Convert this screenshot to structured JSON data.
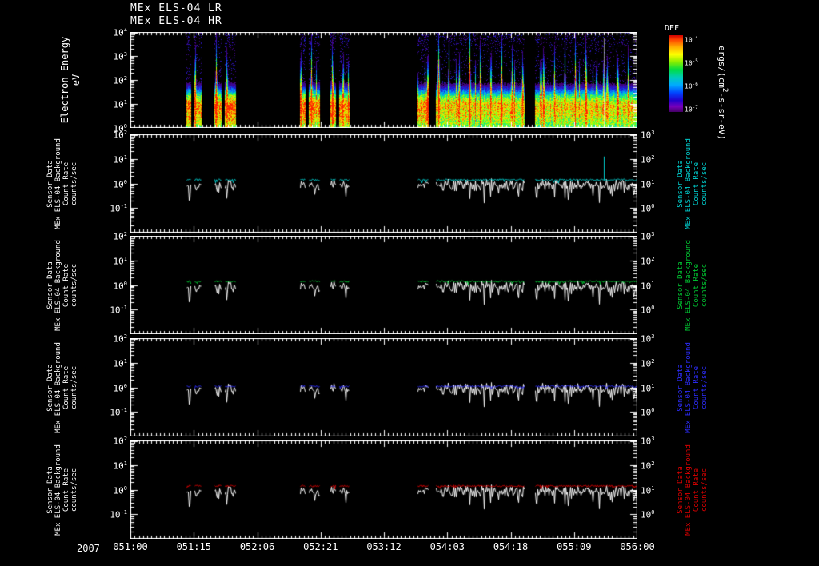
{
  "titles": {
    "line1": "MEx ELS-04 LR",
    "line2": "MEx ELS-04 HR"
  },
  "spectrogram_labels": {
    "ylabel_line1": "Electron Energy",
    "ylabel_line2": "eV",
    "colorbar_title": "DEF",
    "units_label": "ergs/(cm^2-s-sr-eV)"
  },
  "sensor_label_lines": [
    "Sensor Data",
    "MEx ELS-04 Background",
    "Count Rate",
    "counts/sec"
  ],
  "x_axis": {
    "year": "2007"
  },
  "chart_data": {
    "type": "multi-panel-time-series",
    "title": "MEx ELS-04 LR / MEx ELS-04 HR",
    "time_axis": {
      "year": "2007",
      "start_doy_hour": "051:00",
      "end_doy_hour": "056:00",
      "span_hours": 120,
      "tick_interval_hours": 15,
      "tick_labels": [
        "051:00",
        "051:15",
        "052:06",
        "052:21",
        "053:12",
        "054:03",
        "054:18",
        "055:09",
        "056:00"
      ]
    },
    "data_segments_hours": [
      [
        13.2,
        14.4
      ],
      [
        15.1,
        16.9
      ],
      [
        19.9,
        21.5
      ],
      [
        22.3,
        24.9
      ],
      [
        40.1,
        41.5
      ],
      [
        42.3,
        44.8
      ],
      [
        47.3,
        48.6
      ],
      [
        49.4,
        51.8
      ],
      [
        68.0,
        70.6
      ],
      [
        72.3,
        93.3
      ],
      [
        95.8,
        120
      ]
    ],
    "panels": [
      {
        "type": "heatmap",
        "name": "electron-energy-spectrogram",
        "ylabel": "Electron Energy (eV)",
        "yscale": "log",
        "ylim_eV": [
          1,
          10000
        ],
        "y_tick_exponents": [
          4,
          3,
          2,
          1,
          0
        ],
        "colorbar": {
          "label": "DEF",
          "units": "ergs/(cm^2-s-sr-eV)",
          "tick_exponents": [
            -4,
            -5,
            -6,
            -7
          ],
          "palette": "rainbow"
        },
        "artifact_line_hour": 112,
        "features": "Peak differential energy flux (green-yellow) between ~3 and 30 eV; enhancements (cyan-blue) reaching ~1000 eV as vertical striations roughly every 2.5 h; sparse purple counts up to 10^4 eV; black where no data."
      },
      {
        "type": "line",
        "name": "count-rate-panel-cyan",
        "yscale": "log",
        "left_axis": {
          "ylim": [
            0.01,
            100
          ],
          "tick_exponents": [
            2,
            1,
            0,
            -1
          ],
          "series": "count-rate-white"
        },
        "right_axis": {
          "ylim": [
            0.1,
            1000
          ],
          "tick_exponents": [
            3,
            2,
            1,
            0
          ],
          "series": "background-cyan"
        },
        "series": [
          {
            "name": "background-cyan",
            "color": "#00d2d2",
            "axis": "right",
            "typical_counts_per_sec": 14
          },
          {
            "name": "count-rate-white",
            "color": "#ffffff",
            "axis": "left",
            "typical_counts_per_sec": 0.8
          }
        ],
        "spike": {
          "hour": 112,
          "peak_counts_per_sec": 125,
          "axis": "right"
        }
      },
      {
        "type": "line",
        "name": "count-rate-panel-green",
        "yscale": "log",
        "left_axis": {
          "ylim": [
            0.01,
            100
          ],
          "tick_exponents": [
            2,
            1,
            0,
            -1
          ],
          "series": "count-rate-white"
        },
        "right_axis": {
          "ylim": [
            0.1,
            1000
          ],
          "tick_exponents": [
            3,
            2,
            1,
            0
          ],
          "series": "background-green"
        },
        "series": [
          {
            "name": "background-green",
            "color": "#00c832",
            "axis": "right",
            "typical_counts_per_sec": 14
          },
          {
            "name": "count-rate-white",
            "color": "#ffffff",
            "axis": "left",
            "typical_counts_per_sec": 0.8
          }
        ]
      },
      {
        "type": "line",
        "name": "count-rate-panel-blue",
        "yscale": "log",
        "left_axis": {
          "ylim": [
            0.01,
            100
          ],
          "tick_exponents": [
            2,
            1,
            0,
            -1
          ],
          "series": "count-rate-white"
        },
        "right_axis": {
          "ylim": [
            0.1,
            1000
          ],
          "tick_exponents": [
            3,
            2,
            1,
            0
          ],
          "series": "background-blue"
        },
        "series": [
          {
            "name": "background-blue",
            "color": "#2d2dff",
            "axis": "right",
            "typical_counts_per_sec": 11
          },
          {
            "name": "count-rate-white",
            "color": "#ffffff",
            "axis": "left",
            "typical_counts_per_sec": 0.8
          }
        ]
      },
      {
        "type": "line",
        "name": "count-rate-panel-red",
        "yscale": "log",
        "left_axis": {
          "ylim": [
            0.01,
            100
          ],
          "tick_exponents": [
            2,
            1,
            0,
            -1
          ],
          "series": "count-rate-white"
        },
        "right_axis": {
          "ylim": [
            0.1,
            1000
          ],
          "tick_exponents": [
            3,
            2,
            1,
            0
          ],
          "series": "background-red"
        },
        "series": [
          {
            "name": "background-red",
            "color": "#e00000",
            "axis": "right",
            "typical_counts_per_sec": 14
          },
          {
            "name": "count-rate-white",
            "color": "#ffffff",
            "axis": "left",
            "typical_counts_per_sec": 0.8
          }
        ]
      }
    ]
  }
}
